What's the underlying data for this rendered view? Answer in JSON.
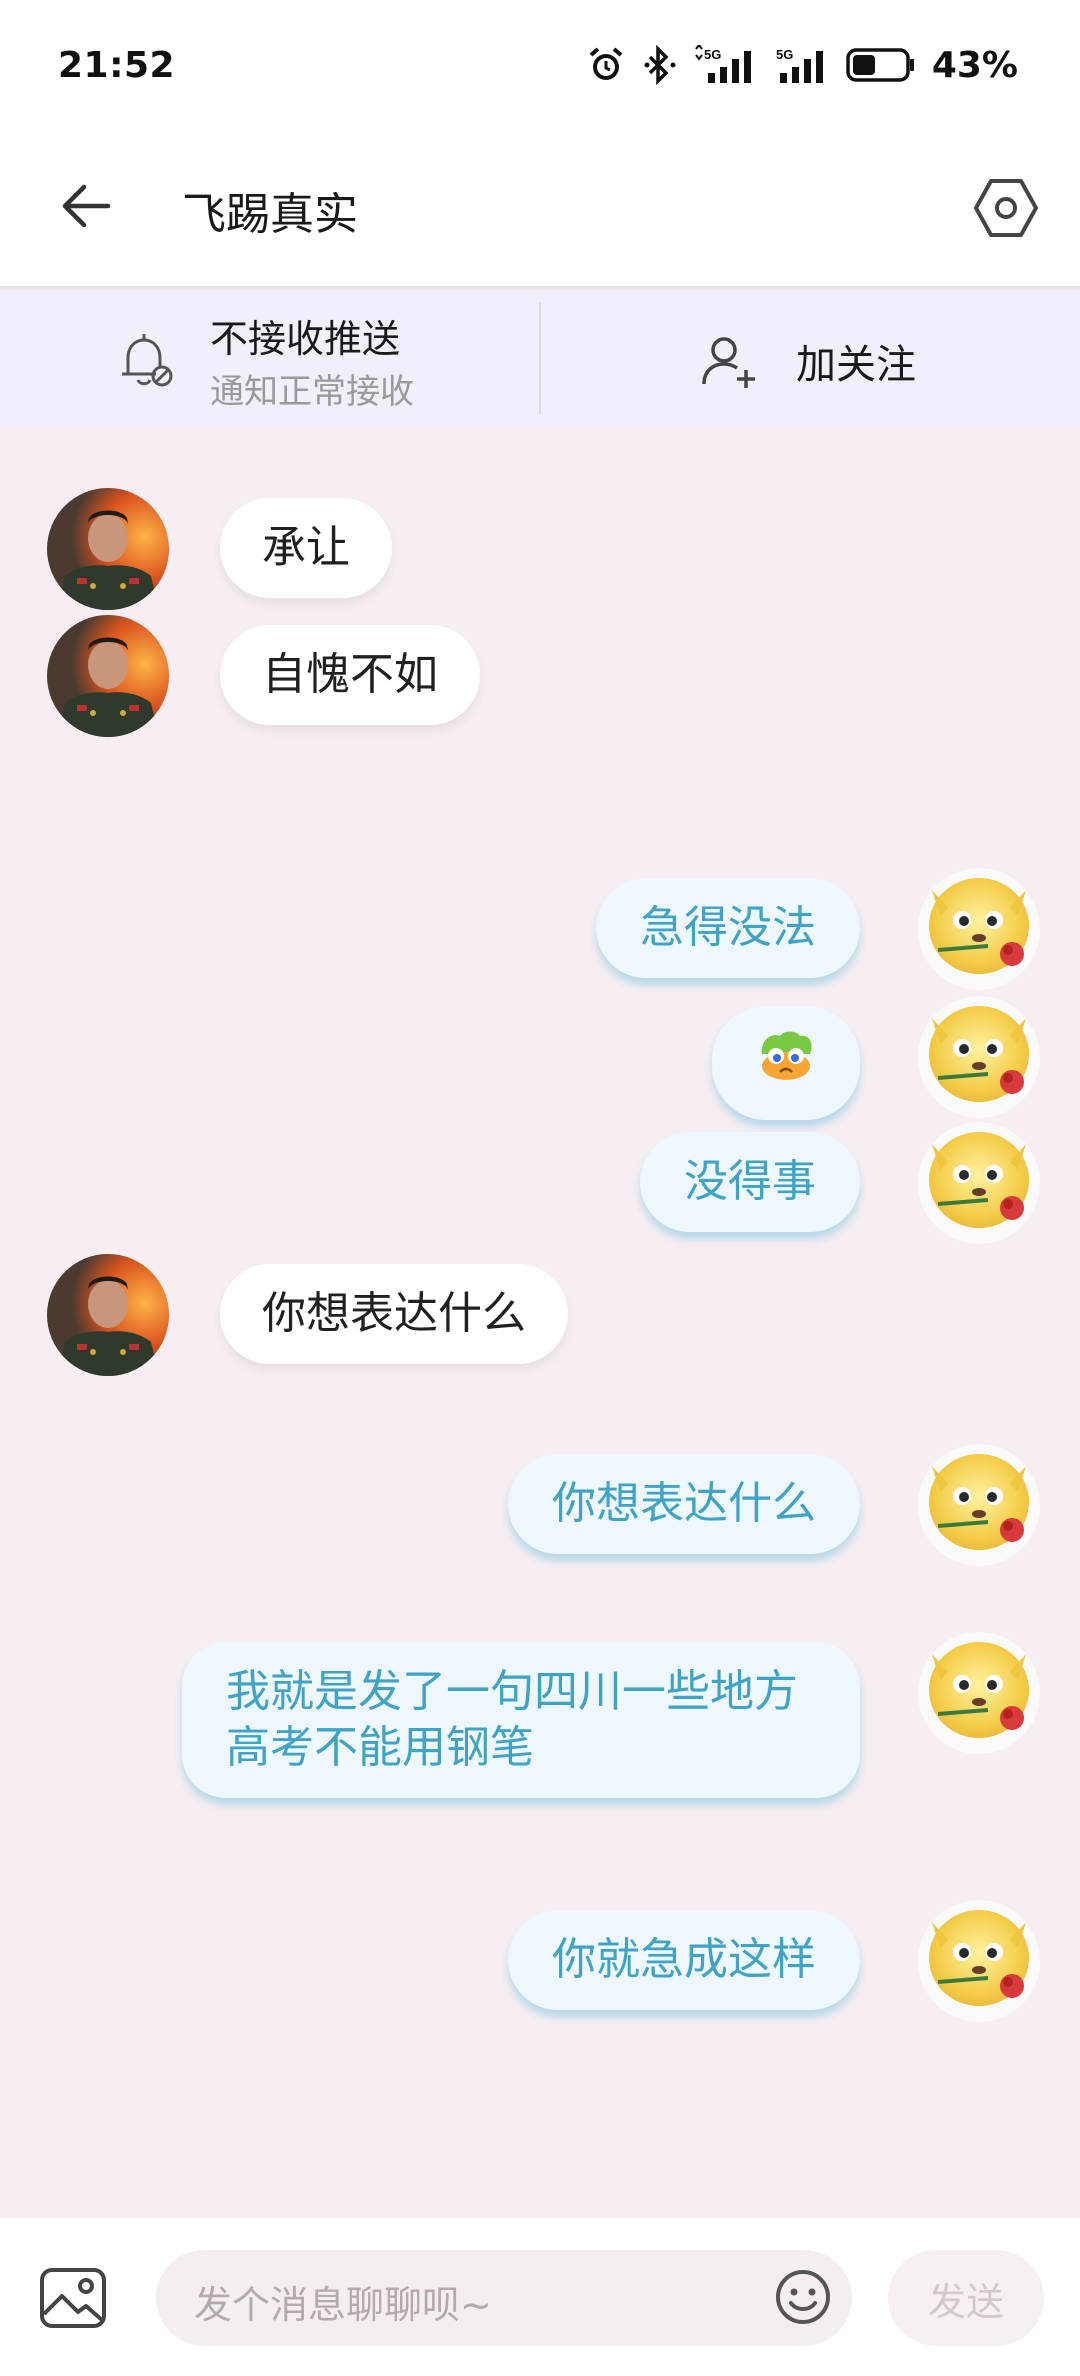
{
  "status_bar": {
    "time": "21:52",
    "battery_percent": "43%",
    "battery_level": 0.43,
    "icons": [
      "alarm-icon",
      "bluetooth-icon",
      "signal-5g-icon",
      "signal-5g-icon",
      "battery-icon"
    ],
    "network_label_1": "5G",
    "network_label_2": "5G"
  },
  "header": {
    "title": "飞踢真实",
    "back_icon": "arrow-left-icon",
    "settings_icon": "hexagon-settings-icon"
  },
  "action_bar": {
    "notify_title": "不接收推送",
    "notify_sub": "通知正常接收",
    "follow_label": "加关注"
  },
  "messages": [
    {
      "side": "in",
      "text": "承让"
    },
    {
      "side": "in",
      "text": "自愧不如"
    },
    {
      "side": "out",
      "text": "急得没法"
    },
    {
      "side": "out",
      "text": "",
      "emoji": "crying-emoji"
    },
    {
      "side": "out",
      "text": "没得事"
    },
    {
      "side": "in",
      "text": "你想表达什么"
    },
    {
      "side": "out",
      "text": "你想表达什么"
    },
    {
      "side": "out",
      "text": "我就是发了一句四川一些地方高考不能用钢笔"
    },
    {
      "side": "out",
      "text": "你就急成这样"
    }
  ],
  "input_bar": {
    "placeholder": "发个消息聊聊呗~",
    "send_label": "发送"
  },
  "colors": {
    "chat_bg": "#f6eef2",
    "out_text": "#3fa3c6",
    "out_bubble": "#eef7fb",
    "in_bubble": "#ffffff"
  }
}
